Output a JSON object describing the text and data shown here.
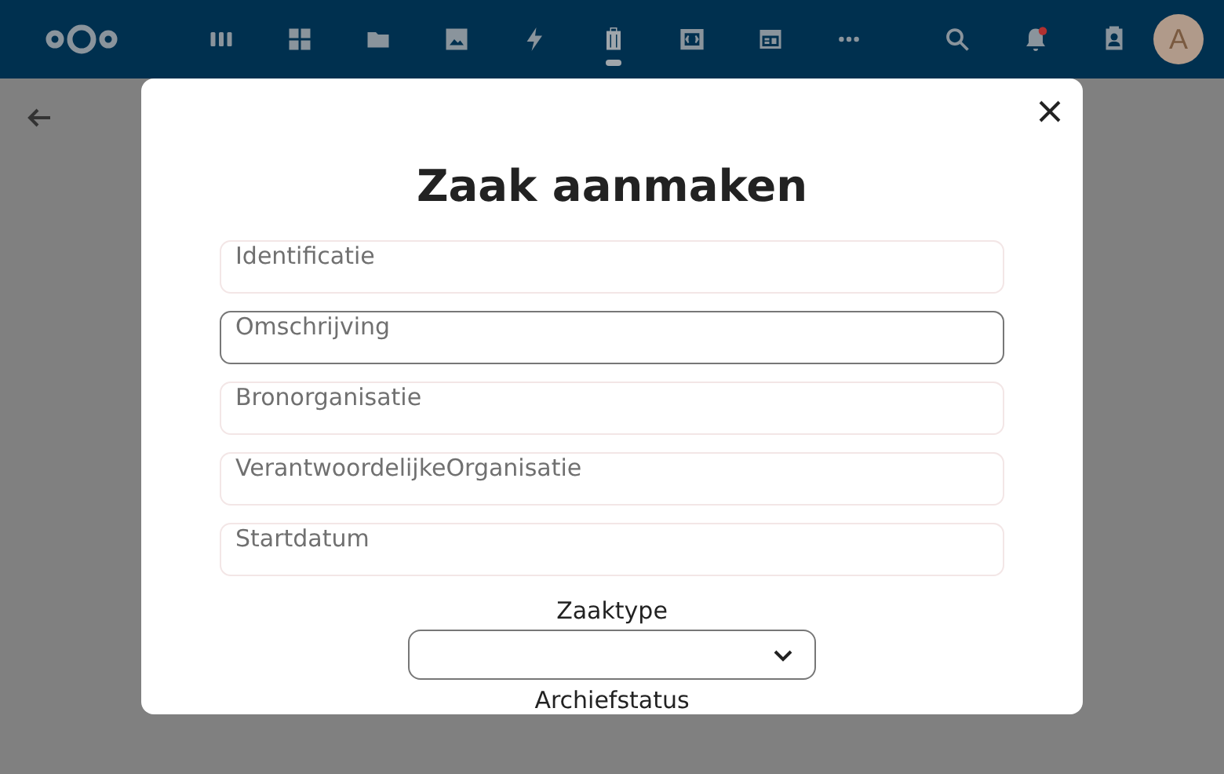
{
  "header": {
    "apps": [
      {
        "kind": "grid",
        "selected": false
      },
      {
        "kind": "dashboard",
        "selected": false
      },
      {
        "kind": "folder",
        "selected": false
      },
      {
        "kind": "image",
        "selected": false
      },
      {
        "kind": "bolt",
        "selected": false
      },
      {
        "kind": "suitcase",
        "selected": true
      },
      {
        "kind": "code",
        "selected": false
      },
      {
        "kind": "table",
        "selected": false
      },
      {
        "kind": "more",
        "selected": false
      }
    ],
    "notifications": {
      "unread": true
    },
    "avatar": "A"
  },
  "dialog": {
    "title": "Zaak aanmaken",
    "fields": [
      {
        "placeholder": "Identificatie",
        "focused": false
      },
      {
        "placeholder": "Omschrijving",
        "focused": true
      },
      {
        "placeholder": "Bronorganisatie",
        "focused": false
      },
      {
        "placeholder": "VerantwoordelijkeOrganisatie",
        "focused": false
      },
      {
        "placeholder": "Startdatum",
        "focused": false
      }
    ],
    "select_label": "Zaaktype",
    "next_label": "Archiefstatus"
  }
}
